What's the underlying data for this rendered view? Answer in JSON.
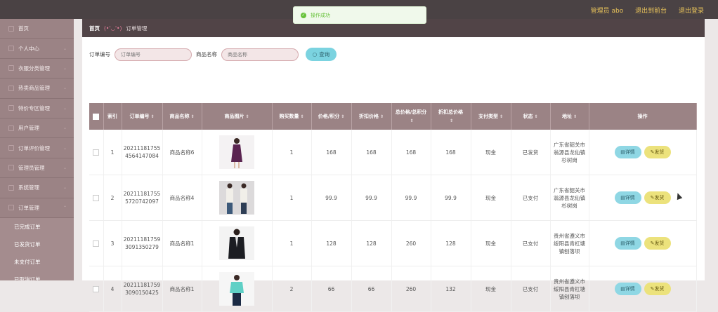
{
  "topbar": {
    "admin_label": "管理员 abo",
    "to_front_label": "退出到前台",
    "logout_label": "退出登录"
  },
  "toast": {
    "message": "操作成功"
  },
  "sidebar": {
    "items": [
      {
        "label": "首页"
      },
      {
        "label": "个人中心"
      },
      {
        "label": "衣服分类管理"
      },
      {
        "label": "热卖商品管理"
      },
      {
        "label": "特价专区管理"
      },
      {
        "label": "用户管理"
      },
      {
        "label": "订单评价管理"
      },
      {
        "label": "管理员管理"
      },
      {
        "label": "系统管理"
      },
      {
        "label": "订单管理"
      }
    ],
    "subitems": [
      {
        "label": "已完成订单"
      },
      {
        "label": "已发货订单"
      },
      {
        "label": "未支付订单"
      },
      {
        "label": "已取消订单"
      }
    ]
  },
  "breadcrumb": {
    "home": "首页",
    "deco": "(•'◡'•)",
    "current": "订单管理"
  },
  "search": {
    "order_label": "订单编号",
    "order_placeholder": "订单编号",
    "product_label": "商品名称",
    "product_placeholder": "商品名称",
    "query_label": "查询"
  },
  "table": {
    "columns": [
      "索引",
      "订单编号",
      "商品名称",
      "商品图片",
      "购买数量",
      "价格/积分",
      "折扣价格",
      "总价格/总积分",
      "折扣总价格",
      "支付类型",
      "状态",
      "地址",
      "操作"
    ],
    "detail_label": "详情",
    "ship_label": "发货",
    "rows": [
      {
        "index": "1",
        "order_no": "20211181755 4564147084",
        "product": "商品名称6",
        "qty": "1",
        "price": "168",
        "discount": "168",
        "total": "168",
        "discount_total": "168",
        "pay": "现金",
        "status": "已发货",
        "address": "广东省韶关市翁源县龙仙镇杉树岗",
        "img": "dress"
      },
      {
        "index": "2",
        "order_no": "20211181755 5720742097",
        "product": "商品名称4",
        "qty": "1",
        "price": "99.9",
        "discount": "99.9",
        "total": "99.9",
        "discount_total": "99.9",
        "pay": "现金",
        "status": "已支付",
        "address": "广东省韶关市翁源县龙仙镇杉树岗",
        "img": "couple"
      },
      {
        "index": "3",
        "order_no": "20211181759 3091350279",
        "product": "商品名称1",
        "qty": "1",
        "price": "128",
        "discount": "128",
        "total": "260",
        "discount_total": "128",
        "pay": "现金",
        "status": "已支付",
        "address": "贵州省遵义市绥阳县青杠塘镇刨落坝",
        "img": "suit"
      },
      {
        "index": "4",
        "order_no": "20211181759 3090150425",
        "product": "商品名称1",
        "qty": "2",
        "price": "66",
        "discount": "66",
        "total": "260",
        "discount_total": "132",
        "pay": "现金",
        "status": "已支付",
        "address": "贵州省遵义市绥阳县青杠塘镇刨落坝",
        "img": "tee"
      }
    ]
  },
  "colors": {
    "sidebar": "#9b8385",
    "header": "#4a4244",
    "accent_cyan": "#8fd7e4",
    "accent_yellow": "#ece27c",
    "toast_green": "#67c23a"
  }
}
